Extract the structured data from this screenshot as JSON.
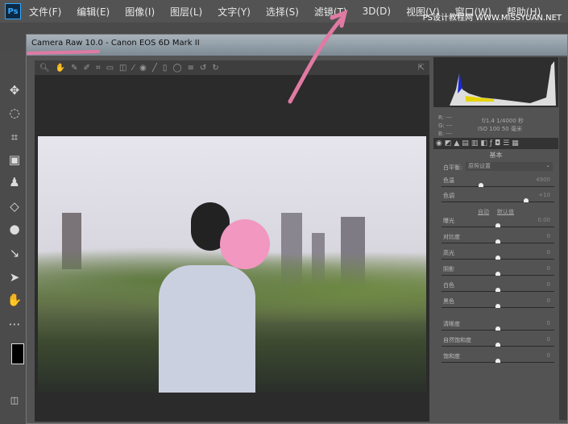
{
  "menubar": {
    "logo": "Ps",
    "items": [
      "文件(F)",
      "编辑(E)",
      "图像(I)",
      "图层(L)",
      "文字(Y)",
      "选择(S)",
      "滤镜(T)",
      "3D(D)",
      "视图(V)",
      "窗口(W)",
      "帮助(H)"
    ],
    "watermark": "PS设计教程网 WWW.MISSYUAN.NET"
  },
  "dialog": {
    "title": "Camera Raw 10.0  -  Canon EOS 6D Mark II"
  },
  "camera_info": {
    "rgb": [
      "R: ---",
      "G: ---",
      "B: ---"
    ],
    "line1": "f/1.4   1/4000 秒",
    "line2": "ISO 100   50 毫米"
  },
  "panel": {
    "title": "基本",
    "wb_label": "白平衡:",
    "wb_value": "原照设置",
    "auto": "自动",
    "default": "默认值",
    "sliders": [
      {
        "label": "色温",
        "value": "4900",
        "pos": 0.35
      },
      {
        "label": "色调",
        "value": "+10",
        "pos": 0.75
      },
      {
        "label": "曝光",
        "value": "0.00",
        "pos": 0.5
      },
      {
        "label": "对比度",
        "value": "0",
        "pos": 0.5
      },
      {
        "label": "高光",
        "value": "0",
        "pos": 0.5
      },
      {
        "label": "阴影",
        "value": "0",
        "pos": 0.5
      },
      {
        "label": "白色",
        "value": "0",
        "pos": 0.5
      },
      {
        "label": "黑色",
        "value": "0",
        "pos": 0.5
      },
      {
        "label": "清晰度",
        "value": "0",
        "pos": 0.5
      },
      {
        "label": "自然饱和度",
        "value": "0",
        "pos": 0.5
      },
      {
        "label": "饱和度",
        "value": "0",
        "pos": 0.5
      }
    ]
  },
  "colors": {
    "accent": "#31a8ff",
    "annotation": "#e07aa3"
  }
}
